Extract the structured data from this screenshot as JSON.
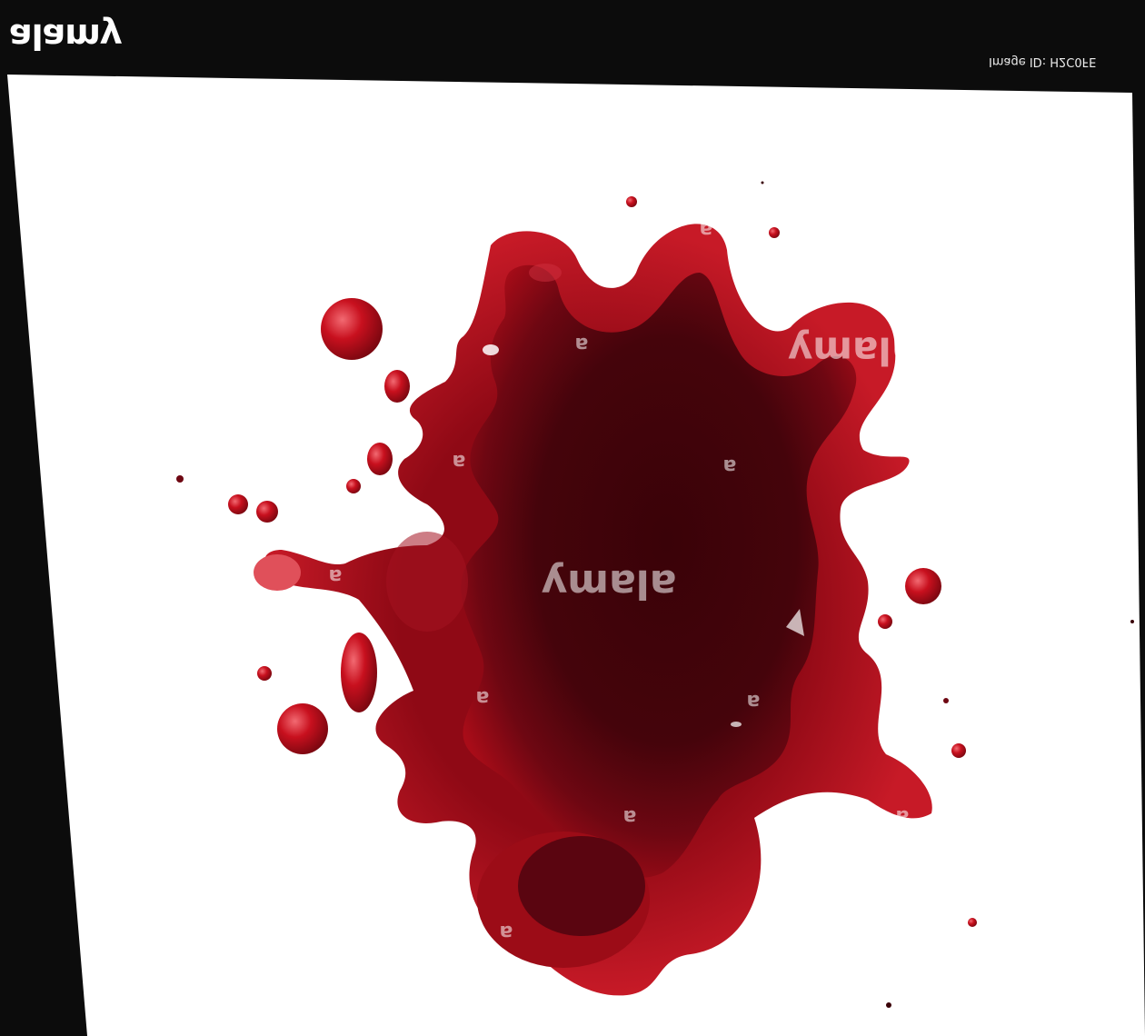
{
  "header": {
    "logo_text": "alamy",
    "image_id": "Image ID: H2C0FE"
  },
  "watermark": {
    "brand": "alamy",
    "mark": "a"
  },
  "colors": {
    "frame": "#0c0c0c",
    "paper": "#ffffff",
    "splat_dark": "#3a0208",
    "splat_mid": "#6e0712",
    "splat_bright": "#c8101e",
    "splat_light": "#e8404a"
  }
}
